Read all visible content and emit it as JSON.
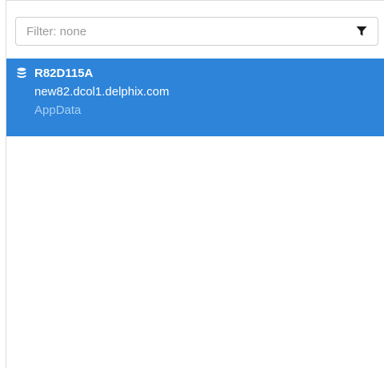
{
  "filter": {
    "placeholder": "Filter: none",
    "value": "",
    "icon": "filter-icon"
  },
  "list": {
    "items": [
      {
        "icon": "database-icon",
        "name": "R82D115A",
        "host": "new82.dcol1.delphix.com",
        "type": "AppData",
        "selected": true
      }
    ]
  },
  "colors": {
    "selected_background": "#2d84d9",
    "selected_text": "#ffffff",
    "selected_subtext": "#a9d0f3",
    "panel_border": "#dcdcdc"
  }
}
